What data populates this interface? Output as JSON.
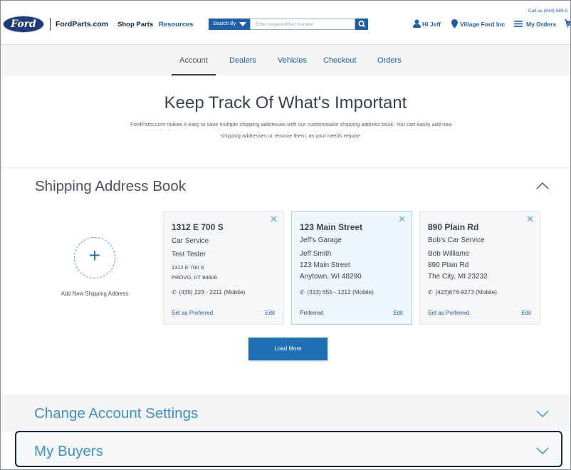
{
  "header": {
    "logo_text": "Ford",
    "site_name": "FordParts.com",
    "nav": [
      "Shop Parts",
      "Resources"
    ],
    "search_by_label": "Search By",
    "search_placeholder": "Enter Keyword/Part Number",
    "call_us": "Call us (844) 589-0",
    "greeting": "Hi Jeff",
    "dealer": "Village Ford Inc",
    "orders": "My Orders"
  },
  "tabs": [
    "Account",
    "Dealers",
    "Vehicles",
    "Checkout",
    "Orders"
  ],
  "active_tab": "Account",
  "hero": {
    "title": "Keep Track Of What's Important",
    "description": "FordParts.com makes it easy to save multiple shipping addresses with our customizable shipping address book. You can easily add new shipping addresses or remove them, as your needs require."
  },
  "shipping": {
    "title": "Shipping Address Book",
    "add_label": "Add New Shipping Address",
    "add_symbol": "+",
    "addresses": [
      {
        "street": "1312 E 700 S",
        "company": "Car Service",
        "name": "Test Tester",
        "address1": "1312 E 700 S",
        "city_state_zip": "PROVO, UT 84606",
        "phone": "(435) 223 - 2211  (Mobile)",
        "preferred": "Set as Preferred",
        "edit": "Edit",
        "close": "✕"
      },
      {
        "street": "123 Main Street",
        "company": "Jeff's Garage",
        "name": "Jeff Smith",
        "address1": "123 Main Street",
        "city_state_zip": "Anytown, WI 48290",
        "phone": "(313) 555 - 1212  (Mobile)",
        "preferred": "Preferred",
        "edit": "Edit",
        "close": "✕"
      },
      {
        "street": "890 Plain Rd",
        "company": "Bob's Car Service",
        "name": "Bob Williams",
        "address1": "890 Plain Rd",
        "city_state_zip": "The City, MI 23232",
        "phone": "(423)678-9273  (Mobile)",
        "preferred": "Set as Preferred",
        "edit": "Edit",
        "close": "✕"
      }
    ],
    "load_more": "Load More"
  },
  "account_settings": {
    "title": "Change Account Settings"
  },
  "my_buyers": {
    "title": "My Buyers"
  },
  "colors": {
    "brand_blue": "#1f5fa8",
    "button_blue": "#1f6fb5",
    "focus_border": "#1b2a3f"
  }
}
